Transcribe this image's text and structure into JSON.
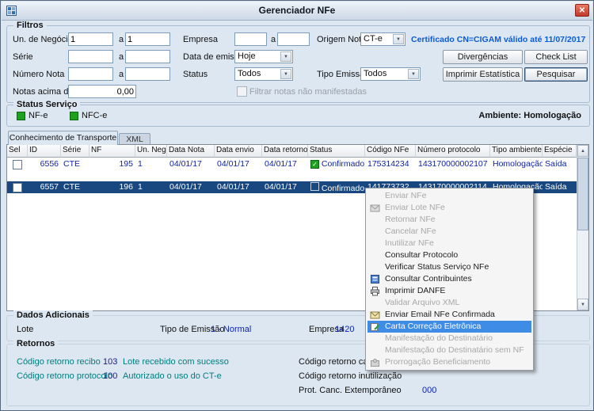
{
  "window": {
    "title": "Gerenciador NFe"
  },
  "icons": {
    "close": "✕",
    "combo_arrow": "▼",
    "scroll_up": "▲",
    "scroll_down": "▼",
    "check": "✓"
  },
  "colors": {
    "accent_cert_blue": "#0a5bd8",
    "value_blue": "#0a23b4",
    "link_teal": "#007d7d",
    "status_green": "#1ca21c",
    "selected_row_blue": "#19477f",
    "menu_highlight_blue": "#3f8ce6"
  },
  "filters": {
    "title": "Filtros",
    "range_sep": "a",
    "un_negocio_label": "Un. de Negócio",
    "un_negocio_from": "1",
    "un_negocio_to": "1",
    "empresa_label": "Empresa",
    "empresa_from": "",
    "empresa_to": "",
    "origem_label": "Origem Nota",
    "origem_value": "CT-e",
    "certificado": "Certificado CN=CIGAM válido até 11/07/2017",
    "serie_label": "Série",
    "serie_from": "",
    "serie_to": "",
    "data_emissao_label": "Data de emissão",
    "data_emissao_value": "Hoje",
    "numero_label": "Número Nota",
    "numero_from": "",
    "numero_to": "",
    "status_label": "Status",
    "status_value": "Todos",
    "tipo_emissao_label": "Tipo Emissão",
    "tipo_emissao_value": "Todos",
    "notas_acima_label": "Notas acima de",
    "notas_acima_value": "0,00",
    "filtrar_label": "Filtrar notas não manifestadas",
    "btn_divergencias": "Divergências",
    "btn_checklist": "Check List",
    "btn_imprimir": "Imprimir Estatística",
    "btn_pesquisar": "Pesquisar"
  },
  "status_servico": {
    "title": "Status Serviço",
    "nfe_label": "NF-e",
    "nfce_label": "NFC-e",
    "ambiente": "Ambiente: Homologação"
  },
  "tabs": {
    "tab1": "Conhecimento de Transporte",
    "tab2": "XML"
  },
  "grid": {
    "columns": [
      "Sel",
      "ID",
      "Série",
      "NF",
      "Un. Neg.",
      "Data Nota",
      "Data envio",
      "Data retorno",
      "Status",
      "Código NFe",
      "Número protocolo",
      "Tipo ambiente",
      "Espécie"
    ],
    "rows": [
      {
        "id": "6556",
        "serie": "CTE",
        "nf": "195",
        "un_neg": "1",
        "data_nota": "04/01/17",
        "data_envio": "04/01/17",
        "data_retorno": "04/01/17",
        "status": "Confirmado",
        "codigo_nfe": "175314234",
        "protocolo": "143170000002107",
        "ambiente": "Homologação",
        "especie": "Saída"
      },
      {
        "id": "6557",
        "serie": "CTE",
        "nf": "196",
        "un_neg": "1",
        "data_nota": "04/01/17",
        "data_envio": "04/01/17",
        "data_retorno": "04/01/17",
        "status": "Confirmado",
        "codigo_nfe": "141773732",
        "protocolo": "143170000002114",
        "ambiente": "Homologação",
        "especie": "Saída"
      }
    ]
  },
  "menu": {
    "items": [
      {
        "label": "Enviar NFe",
        "enabled": false
      },
      {
        "label": "Enviar Lote NFe",
        "enabled": false,
        "icon": "mail-icon"
      },
      {
        "label": "Retornar NFe",
        "enabled": false
      },
      {
        "label": "Cancelar NFe",
        "enabled": false
      },
      {
        "label": "Inutilizar NFe",
        "enabled": false
      },
      {
        "label": "Consultar Protocolo",
        "enabled": true
      },
      {
        "label": "Verificar Status Serviço NFe",
        "enabled": true
      },
      {
        "label": "Consultar Contribuintes",
        "enabled": true,
        "icon": "contacts-icon"
      },
      {
        "label": "Imprimir DANFE",
        "enabled": true,
        "icon": "printer-icon"
      },
      {
        "label": "Validar Arquivo XML",
        "enabled": false
      },
      {
        "label": "Enviar Email NFe Confirmada",
        "enabled": true,
        "icon": "email-icon"
      },
      {
        "label": "Carta Correção Eletrônica",
        "enabled": true,
        "highlighted": true,
        "icon": "letter-pencil-icon"
      },
      {
        "label": "Manifestação do Destinatário",
        "enabled": false
      },
      {
        "label": "Manifestação do Destinatário sem NF",
        "enabled": false
      },
      {
        "label": "Prorrogação Beneficiamento",
        "enabled": false,
        "icon": "puzzle-icon"
      }
    ]
  },
  "dados": {
    "title": "Dados Adicionais",
    "lote_label": "Lote",
    "tipo_label": "Tipo de Emissão",
    "tipo_value": "1 - Normal",
    "empresa_label": "Empresa",
    "empresa_value": "1420"
  },
  "retornos": {
    "title": "Retornos",
    "recibo_label": "Código retorno recibo",
    "recibo_code": "103",
    "recibo_msg": "Lote recebido com sucesso",
    "protocolo_label": "Código retorno protocolo",
    "protocolo_code": "100",
    "protocolo_msg": "Autorizado o uso do CT-e",
    "cancel_label": "Código retorno cancel",
    "inutilizacao_label": "Código retorno inutilização",
    "extemporaneo_label": "Prot. Canc. Extemporâneo",
    "extemporaneo_value": "000"
  }
}
